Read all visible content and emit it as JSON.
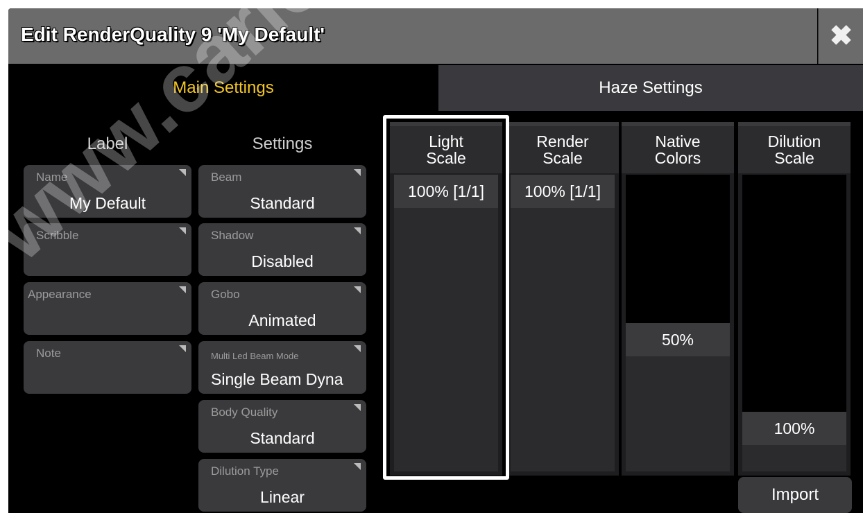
{
  "window": {
    "title": "Edit RenderQuality 9 'My Default'",
    "close_icon": "close-icon"
  },
  "tabs": [
    {
      "label": "Main Settings",
      "active": true
    },
    {
      "label": "Haze Settings",
      "active": false
    }
  ],
  "columns": {
    "label_header": "Label",
    "settings_header": "Settings"
  },
  "label_fields": [
    {
      "label": "Name",
      "value": "My Default"
    },
    {
      "label": "Scribble",
      "value": ""
    },
    {
      "label": "Appearance",
      "value": ""
    },
    {
      "label": "Note",
      "value": ""
    }
  ],
  "settings_fields": [
    {
      "label": "Beam",
      "value": "Standard"
    },
    {
      "label": "Shadow",
      "value": "Disabled"
    },
    {
      "label": "Gobo",
      "value": "Animated"
    },
    {
      "label": "Multi Led Beam Mode",
      "value": "Single Beam Dyna"
    },
    {
      "label": "Body Quality",
      "value": "Standard"
    },
    {
      "label": "Dilution Type",
      "value": "Linear"
    }
  ],
  "scale_columns": [
    {
      "header_line1": "Light",
      "header_line2": "Scale",
      "value": "100% [1/1]",
      "level": 1.0,
      "selected": true
    },
    {
      "header_line1": "Render",
      "header_line2": "Scale",
      "value": "100% [1/1]",
      "level": 1.0,
      "selected": false
    },
    {
      "header_line1": "Native",
      "header_line2": "Colors",
      "value": "50%",
      "level": 0.5,
      "selected": false
    },
    {
      "header_line1": "Dilution",
      "header_line2": "Scale",
      "value": "100%",
      "level": 0.2,
      "selected": false
    }
  ],
  "import_button": "Import",
  "watermark": "www.carlosm",
  "colors": {
    "accent": "#f3c623",
    "panel": "#3a3a3d",
    "background": "#000000"
  }
}
